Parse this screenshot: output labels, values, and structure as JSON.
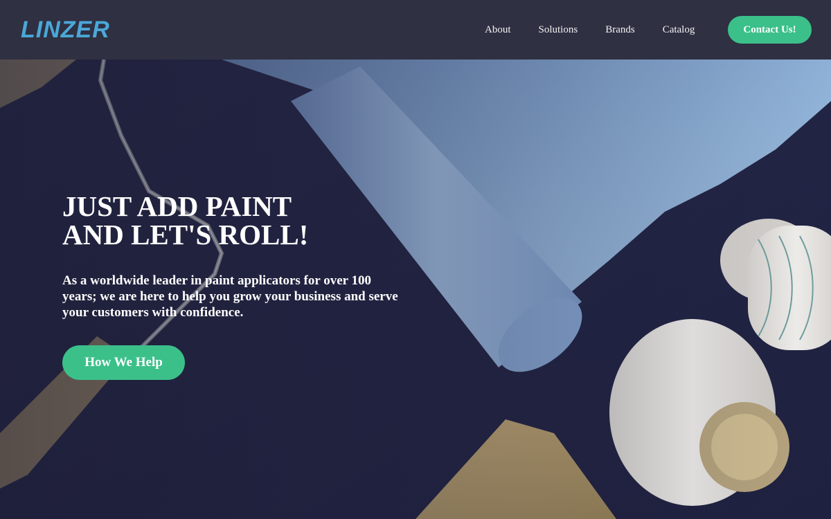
{
  "brand": {
    "logo_text": "LINZER",
    "logo_color": "#4aa8d8"
  },
  "nav": {
    "items": [
      {
        "label": "About"
      },
      {
        "label": "Solutions"
      },
      {
        "label": "Brands"
      },
      {
        "label": "Catalog"
      }
    ],
    "contact_label": "Contact Us!"
  },
  "hero": {
    "headline_line1": "JUST ADD PAINT",
    "headline_line2": "AND LET'S ROLL!",
    "subtext": "As a worldwide leader in paint applicators for over 100 years; we are here to help you grow your business and serve your customers with confidence.",
    "cta_label": "How We Help",
    "background_image": "paint-roller-photo"
  },
  "colors": {
    "header_bg": "#2f3042",
    "accent_green": "#3cc08a",
    "hero_overlay": "#2b2c44",
    "paint_blue": "#8fb6d8"
  }
}
